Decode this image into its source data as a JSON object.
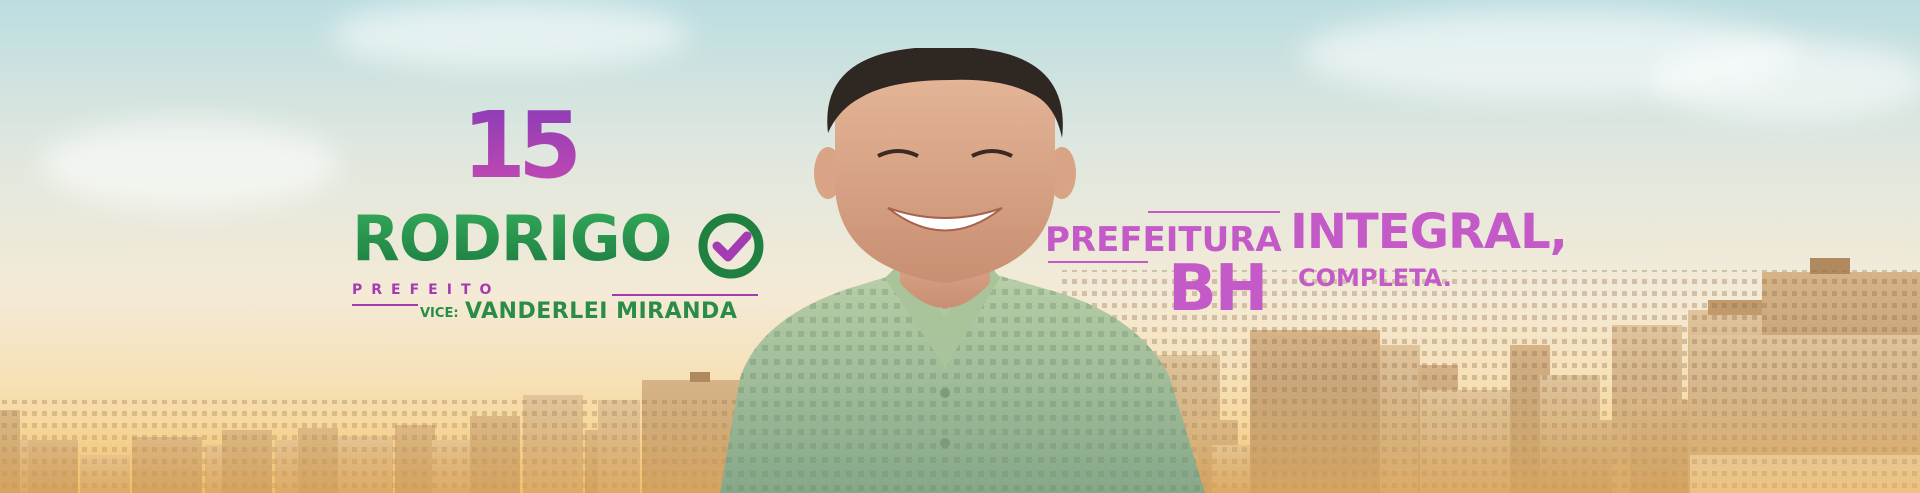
{
  "banner": {
    "number": "15",
    "name": "RODRIGO",
    "role": "PREFEITO",
    "vice_label": "VICE:",
    "vice_name": "VANDERLEI MIRANDA",
    "slogan_part1": "PREFEITURA",
    "slogan_part2": "INTEGRAL,",
    "slogan_part3": "BH",
    "slogan_part4": "COMPLETA."
  },
  "colors": {
    "purple": "#a33bb3",
    "green": "#2a8c47",
    "slogan_pink": "#c45ac8"
  }
}
